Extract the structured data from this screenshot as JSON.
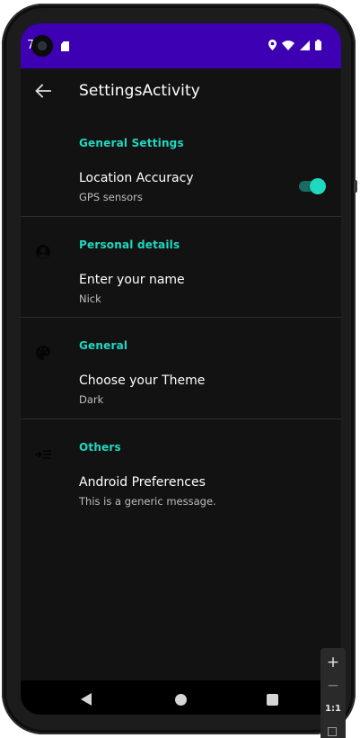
{
  "status_bar": {
    "time": "7",
    "bg_color": "#3d00b3",
    "icons": [
      "camera-icon",
      "sd-card-icon",
      "location-icon",
      "wifi-icon",
      "signal-icon",
      "battery-icon"
    ]
  },
  "toolbar": {
    "title": "SettingsActivity",
    "back_icon": "arrow-left-icon"
  },
  "accent_color": "#1fd8c0",
  "categories": [
    {
      "title": "General Settings",
      "icon": "",
      "item": {
        "title": "Location Accuracy",
        "summary": "GPS sensors",
        "switch_on": true
      }
    },
    {
      "title": "Personal details",
      "icon": "account-circle-icon",
      "item": {
        "title": "Enter your name",
        "summary": "Nick"
      }
    },
    {
      "title": "General",
      "icon": "palette-icon",
      "item": {
        "title": "Choose your Theme",
        "summary": "Dark"
      }
    },
    {
      "title": "Others",
      "icon": "menu-open-icon",
      "item": {
        "title": "Android Preferences",
        "summary": "This is a generic message."
      }
    }
  ],
  "nav_bar": {
    "icons": [
      "nav-back-icon",
      "nav-home-icon",
      "nav-recents-icon"
    ]
  },
  "zoom_controls": {
    "zoom_in": "+",
    "zoom_out": "−",
    "reset": "1:1"
  }
}
